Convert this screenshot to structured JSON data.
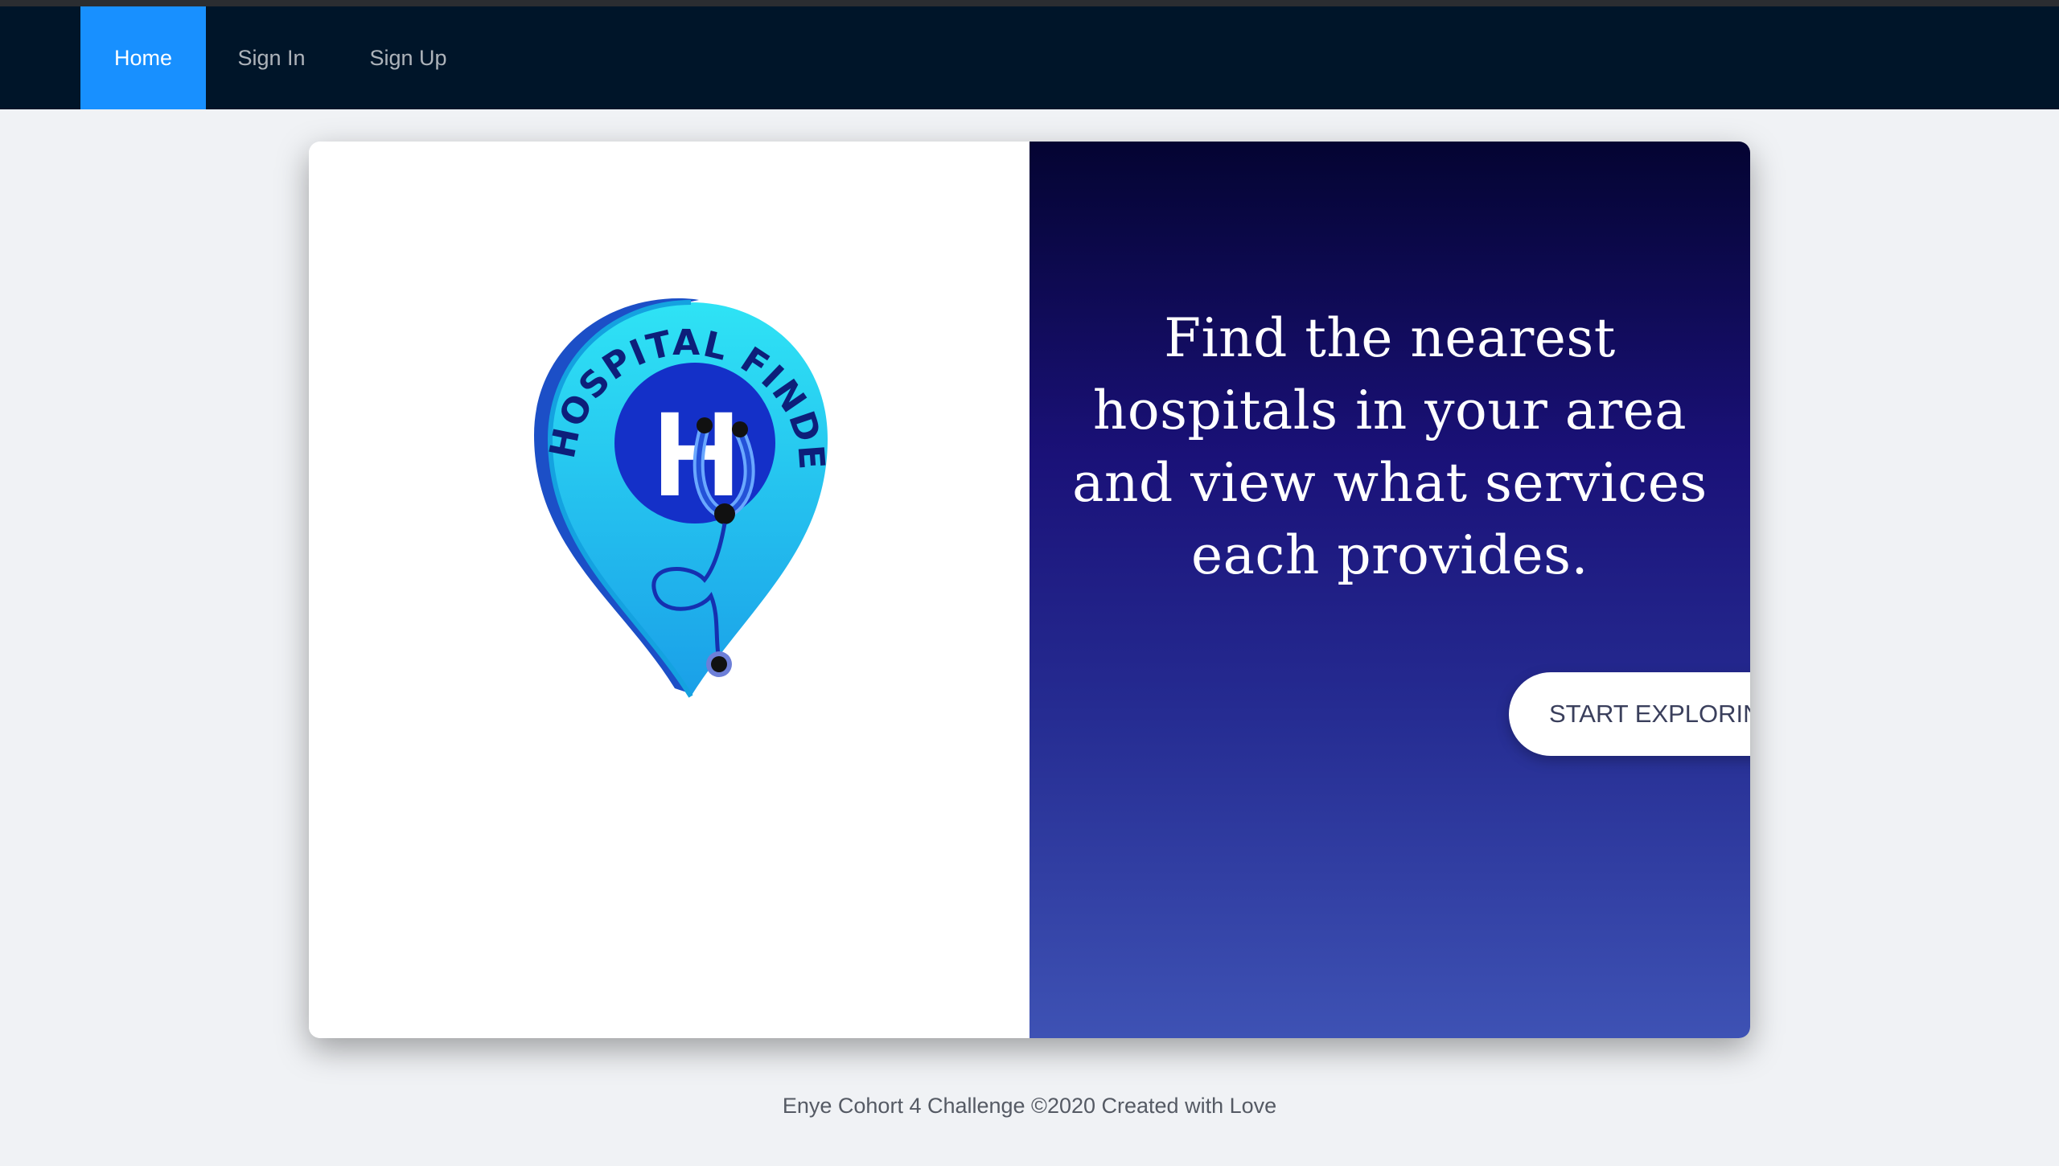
{
  "nav": {
    "items": [
      {
        "label": "Home",
        "active": true
      },
      {
        "label": "Sign In",
        "active": false
      },
      {
        "label": "Sign Up",
        "active": false
      }
    ]
  },
  "hero": {
    "headline": "Find the nearest hospitals in your area and view what services each provides.",
    "cta_label": "START EXPLORING NOW"
  },
  "logo": {
    "text": "HOSPITAL FINDER",
    "letter": "H",
    "icon": "map-pin-stethoscope-icon"
  },
  "footer": {
    "text": "Enye Cohort 4 Challenge ©2020 Created with Love"
  },
  "colors": {
    "navbar": "#001529",
    "nav_active": "#1890ff",
    "gradient_top": "#040432",
    "gradient_bottom": "#3e52b4"
  }
}
